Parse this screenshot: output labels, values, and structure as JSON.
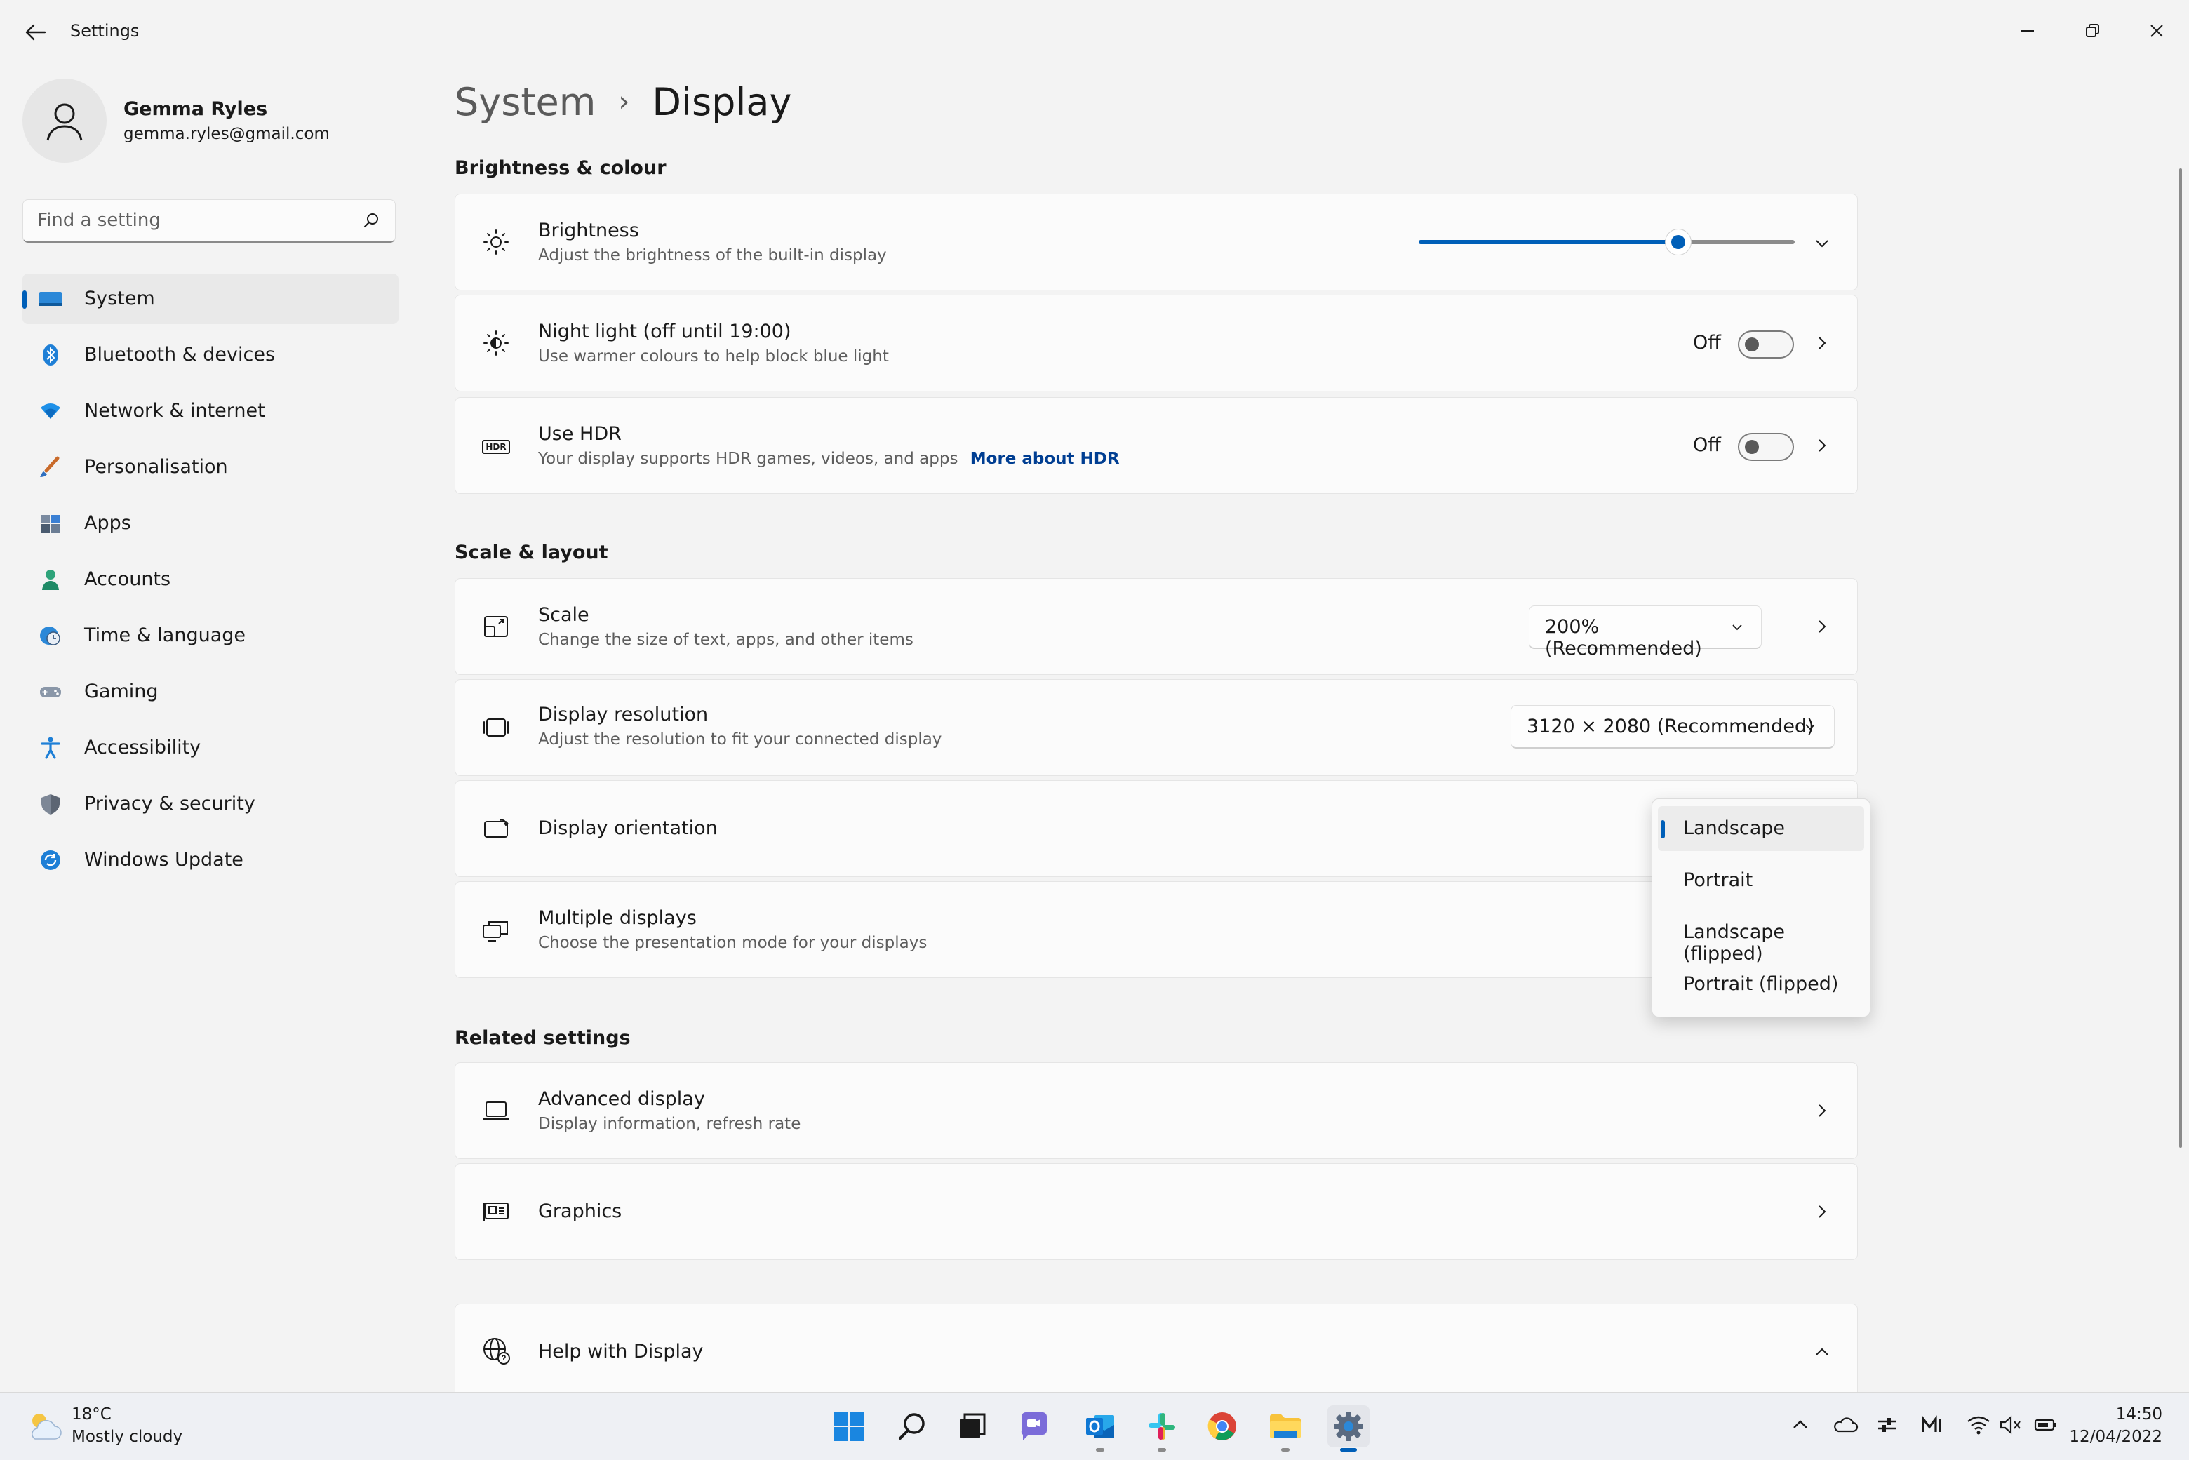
{
  "window": {
    "title": "Settings"
  },
  "user": {
    "name": "Gemma Ryles",
    "email": "gemma.ryles@gmail.com"
  },
  "search": {
    "placeholder": "Find a setting"
  },
  "sidebar": {
    "items": [
      {
        "label": "System",
        "icon": "monitor-icon",
        "active": true
      },
      {
        "label": "Bluetooth & devices",
        "icon": "bluetooth-icon"
      },
      {
        "label": "Network & internet",
        "icon": "wifi-icon"
      },
      {
        "label": "Personalisation",
        "icon": "brush-icon"
      },
      {
        "label": "Apps",
        "icon": "apps-icon"
      },
      {
        "label": "Accounts",
        "icon": "person-icon"
      },
      {
        "label": "Time & language",
        "icon": "globe-clock-icon"
      },
      {
        "label": "Gaming",
        "icon": "gamepad-icon"
      },
      {
        "label": "Accessibility",
        "icon": "accessibility-icon"
      },
      {
        "label": "Privacy & security",
        "icon": "shield-icon"
      },
      {
        "label": "Windows Update",
        "icon": "update-icon"
      }
    ]
  },
  "breadcrumb": {
    "parent": "System",
    "separator": "›",
    "current": "Display"
  },
  "sections": {
    "brightness_colour": "Brightness & colour",
    "scale_layout": "Scale & layout",
    "related": "Related settings"
  },
  "brightness": {
    "title": "Brightness",
    "subtitle": "Adjust the brightness of the built-in display",
    "value": 0.69
  },
  "night_light": {
    "title": "Night light (off until 19:00)",
    "subtitle": "Use warmer colours to help block blue light",
    "state": "Off"
  },
  "hdr": {
    "title": "Use HDR",
    "subtitle": "Your display supports HDR games, videos, and apps",
    "link": "More about HDR",
    "state": "Off",
    "badge": "HDR"
  },
  "scale": {
    "title": "Scale",
    "subtitle": "Change the size of text, apps, and other items",
    "value": "200% (Recommended)"
  },
  "resolution": {
    "title": "Display resolution",
    "subtitle": "Adjust the resolution to fit your connected display",
    "value": "3120 × 2080 (Recommended)"
  },
  "orientation": {
    "title": "Display orientation",
    "options": [
      "Landscape",
      "Portrait",
      "Landscape (flipped)",
      "Portrait (flipped)"
    ],
    "selected": "Landscape"
  },
  "multiple": {
    "title": "Multiple displays",
    "subtitle": "Choose the presentation mode for your displays"
  },
  "advanced": {
    "title": "Advanced display",
    "subtitle": "Display information, refresh rate"
  },
  "graphics": {
    "title": "Graphics"
  },
  "help": {
    "title": "Help with Display"
  },
  "taskbar": {
    "weather": {
      "temp": "18°C",
      "desc": "Mostly cloudy"
    },
    "clock": {
      "time": "14:50",
      "date": "12/04/2022"
    }
  },
  "colors": {
    "accent": "#005fb8",
    "background": "#f3f3f3",
    "card": "#fbfbfb"
  }
}
